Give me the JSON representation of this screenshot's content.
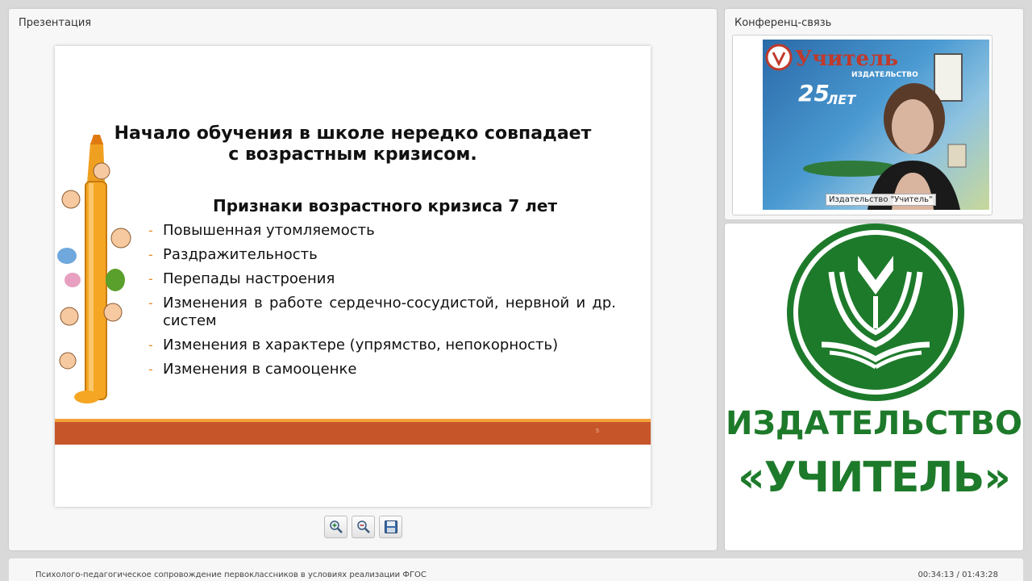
{
  "presentation": {
    "title": "Презентация",
    "slide": {
      "heading_line1": "Начало обучения в школе нередко  совпадает",
      "heading_line2": "с возрастным кризисом.",
      "subheading": "Признаки возрастного кризиса 7 лет",
      "items": [
        "Повышенная утомляемость",
        "Раздражительность",
        "Перепады настроения",
        "Изменения в работе сердечно-сосудистой, нервной и др. систем",
        "Изменения в характере (упрямство, непокорность)",
        "Изменения в самооценке"
      ],
      "page_number": "5",
      "accent_color": "#c7552a",
      "stripe_color": "#f3a13a"
    },
    "toolbar": {
      "zoom_in_icon": "zoom-in-icon",
      "zoom_out_icon": "zoom-out-icon",
      "save_icon": "save-icon"
    }
  },
  "conference": {
    "title": "Конференц-связь",
    "participant_label": "Издательство \"Учитель\"",
    "banner_brand": "Учитель",
    "banner_sub": "ИЗДАТЕЛЬСТВО",
    "banner_years": "25",
    "banner_text": "ЛЕТ"
  },
  "logo": {
    "line1": "ИЗДАТЕЛЬСТВО",
    "line2": "«УЧИТЕЛЬ»",
    "color": "#1d7a2a"
  },
  "status_bar": {
    "webinar_title": "Психолого-педагогическое сопровождение первоклассников в условиях реализации ФГОС",
    "time": "00:34:13 / 01:43:28"
  }
}
